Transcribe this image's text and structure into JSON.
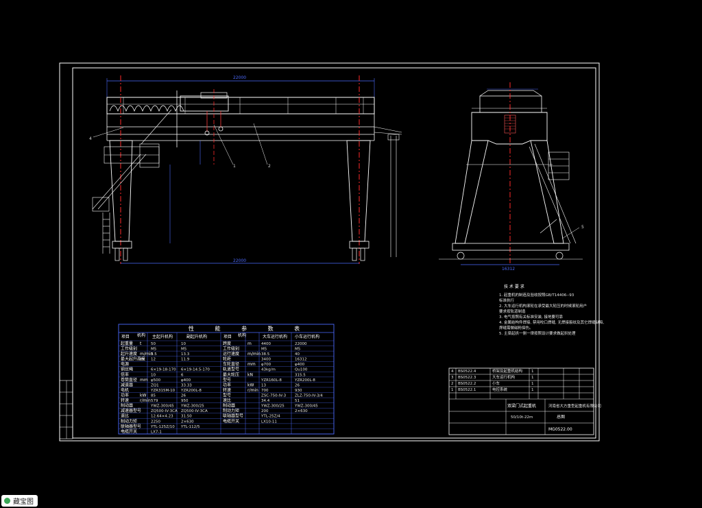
{
  "tech_notes": {
    "title": "技 术 要 求",
    "items": [
      "1. 起重机的制造及验收按照GB/T14406--93",
      "   标准执行",
      "2. 大车运行机构滚轮在承受最大轮压的时候滚轮用户",
      "   要求按轨道制造",
      "3. 电气按照有关标准安装, 接地要可靠",
      "4. 金属结构件焊接, 禁用咬口焊缝, 无焊接裂纹及其它焊缝缺陷,",
      "   焊缝需做磁粉探伤。",
      "5. 主梁起拱一侧一律按照设计要求做起拱处理"
    ]
  },
  "params": {
    "header": "性 能 参 数 表",
    "row1_left": [
      "项目",
      "机构",
      "主起升机构",
      "副起升机构"
    ],
    "row1_right": [
      "项目",
      "机构",
      "大车运行机构",
      "小车运行机构"
    ],
    "left_rows": [
      [
        "起重量",
        "t",
        "50",
        "10"
      ],
      [
        "工作级别",
        "",
        "M5",
        "M5"
      ],
      [
        "起升速度",
        "m/min",
        "3.5",
        "13.3"
      ],
      [
        "最大起升高度",
        "m",
        "12",
        "11.9"
      ],
      [
        "电源",
        "",
        "",
        ""
      ],
      [
        "钢丝绳",
        "",
        "6×19-18-170",
        "6×19-14.5-170"
      ],
      [
        "倍率",
        "",
        "10",
        "6"
      ],
      [
        "卷筒直径",
        "mm",
        "φ500",
        "φ400"
      ],
      [
        "减速器",
        "",
        "ZQ1",
        "33.33"
      ],
      [
        "电机",
        "",
        "YZR315M-10",
        "YZR200L-8"
      ],
      [
        "功率",
        "kW",
        "85",
        "26"
      ],
      [
        "转速",
        "r/min",
        "579",
        "950"
      ],
      [
        "制动器",
        "",
        "YWZ-300/45",
        "YWZ-300/25"
      ],
      [
        "减速器型号",
        "",
        "ZQ500-IV-3CA",
        "ZQ500-IV-3CA"
      ],
      [
        "速比",
        "",
        "12.64×4.23",
        "31.50"
      ],
      [
        "制动力矩",
        "",
        "2250",
        "2×630"
      ],
      [
        "联轴器型号",
        "",
        "YTL-125Z/10",
        "YTL-112/5"
      ],
      [
        "电缆开关",
        "",
        "LX7-1",
        ""
      ]
    ],
    "power_label": "交 流 三 相",
    "power_value": "50HZ",
    "power_volt": "380V",
    "right_rows": [
      [
        "跨度",
        "m",
        "4400",
        "22000"
      ],
      [
        "工作级别",
        "",
        "M5",
        "M5"
      ],
      [
        "运行速度",
        "m/min",
        "38.5",
        "40"
      ],
      [
        "轮距",
        "",
        "3400",
        "16312"
      ],
      [
        "车轮直径",
        "mm",
        "φ700",
        "φ400"
      ],
      [
        "轨道型号",
        "",
        "43kg/m",
        "Qu100"
      ],
      [
        "最大轮压",
        "kN",
        "",
        "315.5"
      ],
      [
        "型号",
        "",
        "YZR160L-8",
        "YZR200L-8"
      ],
      [
        "功率",
        "kW",
        "13",
        "26"
      ],
      [
        "转速",
        "r/min",
        "700",
        "930"
      ],
      [
        "型号",
        "",
        "ZSC-750-IV-3",
        "ZLZ-750-IV-3/4"
      ],
      [
        "速比",
        "",
        "34.4",
        "51"
      ],
      [
        "制动器",
        "",
        "YWZ-300/25",
        "YWZ-300/45"
      ],
      [
        "制动力矩",
        "",
        "200",
        "2×630"
      ],
      [
        "联轴器型号",
        "",
        "YTL-25Z/4",
        ""
      ],
      [
        "电缆开关",
        "",
        "LX10-11",
        ""
      ]
    ]
  },
  "title_block": {
    "rows": [
      [
        "4",
        "BS0522.4",
        "桥架及起重机结构",
        "1",
        ""
      ],
      [
        "3",
        "BS0522.3",
        "大车运行机构",
        "1",
        ""
      ],
      [
        "2",
        "BS0522.2",
        "小车",
        "1",
        ""
      ],
      [
        "1",
        "BS0522.1",
        "电控系统",
        "1",
        ""
      ]
    ],
    "machine_name": "双梁门式起重机",
    "company": "河南省大方重型起重机有限公司",
    "drawing_name": "总图",
    "spec": "50/10t-22m",
    "drawing_no": "MG0522.00"
  },
  "callouts": [
    "1",
    "2",
    "4",
    "5"
  ],
  "dims": {
    "span_top": "22000",
    "span_bottom": "22000",
    "side_bottom": "16312"
  },
  "badge": "藏宝图"
}
